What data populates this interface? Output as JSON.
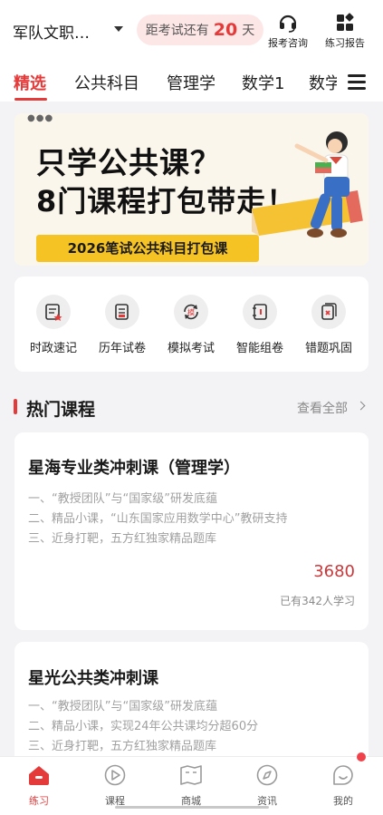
{
  "header": {
    "school": "军队文职…",
    "countdown_prefix": "距考试还有",
    "countdown_days": "20",
    "countdown_suffix": "天",
    "consult_label": "报考咨询",
    "report_label": "练习报告"
  },
  "tabs": [
    {
      "label": "精选",
      "active": true
    },
    {
      "label": "公共科目"
    },
    {
      "label": "管理学"
    },
    {
      "label": "数学1"
    },
    {
      "label": "数学"
    }
  ],
  "banner": {
    "line1": "只学公共课？",
    "line2": "8门课程打包带走！",
    "tag": "2026笔试公共科目打包课"
  },
  "quick_menu": [
    {
      "label": "时政速记",
      "icon": "news-icon"
    },
    {
      "label": "历年试卷",
      "icon": "paper-icon"
    },
    {
      "label": "模拟考试",
      "icon": "mock-exam-icon"
    },
    {
      "label": "智能组卷",
      "icon": "smart-compose-icon"
    },
    {
      "label": "错题巩固",
      "icon": "wrong-questions-icon"
    }
  ],
  "hot_courses": {
    "title": "热门课程",
    "more": "查看全部"
  },
  "courses": [
    {
      "title": "星海专业类冲刺课（管理学）",
      "lines": [
        "一、“教授团队”与“国家级”研发底蕴",
        "二、精品小课，“山东国家应用数学中心”教研支持",
        "三、近身打靶，五方红独家精品题库"
      ],
      "price": "3680",
      "learners": "已有342人学习"
    },
    {
      "title": "星光公共类冲刺课",
      "lines": [
        "一、“教授团队”与“国家级”研发底蕴",
        "二、精品小课，实现24年公共课均分超60分",
        "三、近身打靶，五方红独家精品题库"
      ]
    }
  ],
  "bottom_nav": [
    {
      "label": "练习",
      "icon": "home-icon",
      "active": true
    },
    {
      "label": "课程",
      "icon": "play-icon"
    },
    {
      "label": "商城",
      "icon": "shop-icon"
    },
    {
      "label": "资讯",
      "icon": "compass-icon"
    },
    {
      "label": "我的",
      "icon": "profile-icon"
    }
  ],
  "colors": {
    "accent": "#e43a3a",
    "banner_tag": "#f6c324"
  }
}
